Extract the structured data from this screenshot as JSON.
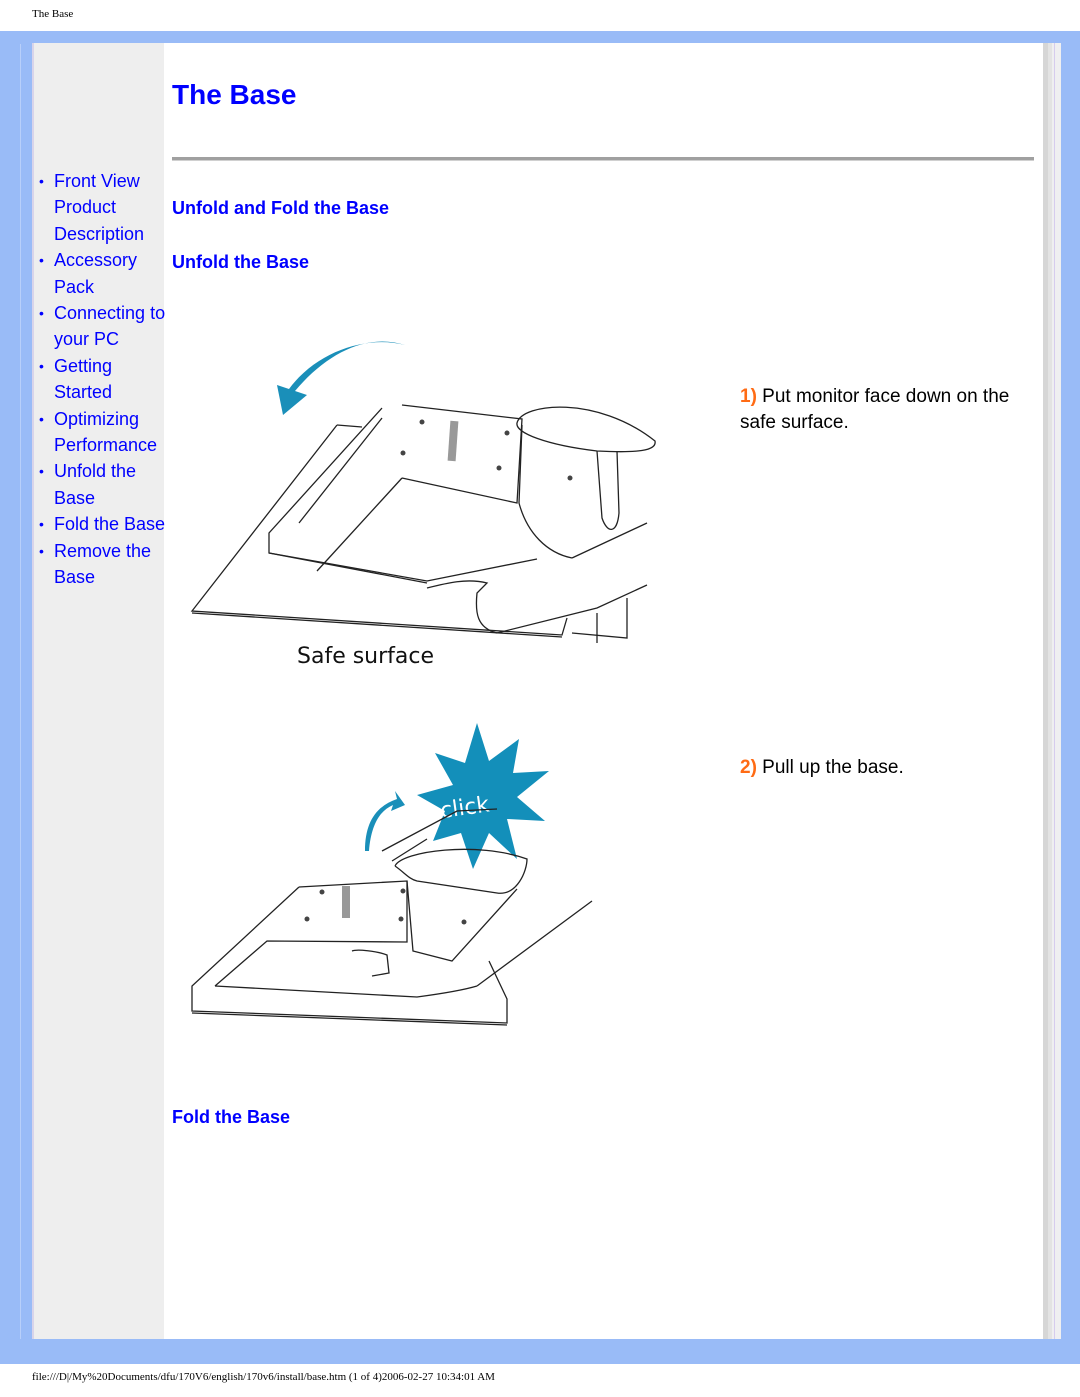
{
  "browser": {
    "page_header_title": "The Base",
    "footer_path": "file:///D|/My%20Documents/dfu/170V6/english/170v6/install/base.htm (1 of 4)2006-02-27 10:34:01 AM"
  },
  "sidebar": {
    "items": [
      {
        "label": "Front View Product Description"
      },
      {
        "label": "Accessory Pack"
      },
      {
        "label": "Connecting to your PC"
      },
      {
        "label": "Getting Started"
      },
      {
        "label": "Optimizing Performance"
      },
      {
        "label": "Unfold the Base"
      },
      {
        "label": "Fold the Base"
      },
      {
        "label": "Remove the Base"
      }
    ]
  },
  "main": {
    "title": "The Base",
    "section_title": "Unfold and Fold the Base",
    "unfold_title": "Unfold the Base",
    "fold_title": "Fold the Base",
    "steps": [
      {
        "number": "1)",
        "text": " Put monitor face down on the safe surface."
      },
      {
        "number": "2)",
        "text": " Pull up the base."
      }
    ],
    "illustrations": [
      {
        "caption": "Safe surface",
        "arrow_color": "#1a8fb9"
      },
      {
        "burst_text": "click",
        "burst_color": "#138fba"
      }
    ]
  },
  "colors": {
    "link": "#0000ff",
    "step_number": "#ff6b14",
    "frame": "#99bbf7",
    "sidebar": "#eeeeee"
  }
}
